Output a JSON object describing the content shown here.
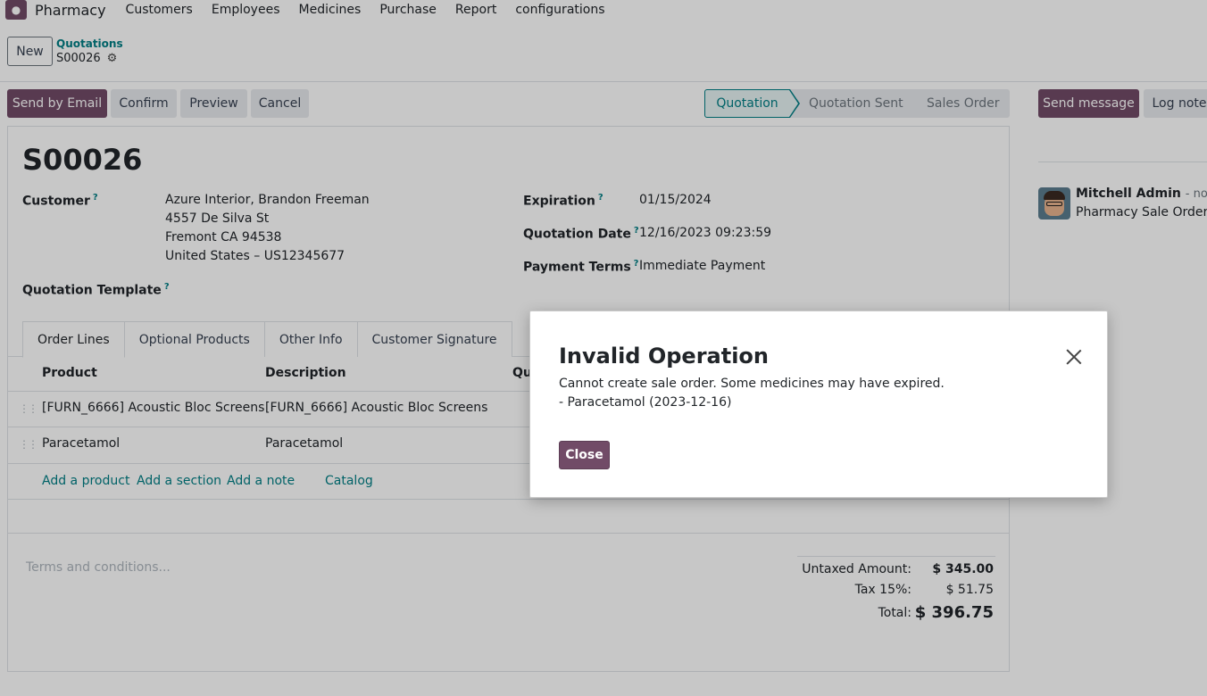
{
  "app": {
    "name": "Pharmacy",
    "icon": "app-logo-icon"
  },
  "menu": [
    "Customers",
    "Employees",
    "Medicines",
    "Purchase",
    "Report",
    "configurations"
  ],
  "control": {
    "new_label": "New",
    "breadcrumb_parent": "Quotations",
    "breadcrumb_current": "S00026"
  },
  "actions": {
    "send_email": "Send by Email",
    "confirm": "Confirm",
    "preview": "Preview",
    "cancel": "Cancel"
  },
  "stages": {
    "active": "Quotation",
    "sent": "Quotation Sent",
    "order": "Sales Order"
  },
  "chatter": {
    "send_message": "Send message",
    "log_note": "Log note",
    "author": "Mitchell Admin",
    "time": "- now",
    "message": "Pharmacy Sale Order cr"
  },
  "form": {
    "title": "S00026",
    "customer_label": "Customer",
    "customer_lines": [
      "Azure Interior, Brandon Freeman",
      "4557 De Silva St",
      "Fremont CA 94538",
      "United States – US12345677"
    ],
    "template_label": "Quotation Template",
    "expiration_label": "Expiration",
    "expiration_value": "01/15/2024",
    "quotation_date_label": "Quotation Date",
    "quotation_date_value": "12/16/2023 09:23:59",
    "payment_terms_label": "Payment Terms",
    "payment_terms_value": "Immediate Payment",
    "help_mark": "?"
  },
  "tabs": [
    "Order Lines",
    "Optional Products",
    "Other Info",
    "Customer Signature"
  ],
  "table": {
    "headers": {
      "product": "Product",
      "description": "Description",
      "quantity": "Qu"
    },
    "rows": [
      {
        "product": "[FURN_6666] Acoustic Bloc Screens",
        "description": "[FURN_6666] Acoustic Bloc Screens"
      },
      {
        "product": "Paracetamol",
        "description": "Paracetamol"
      }
    ],
    "add_product": "Add a product",
    "add_section": "Add a section",
    "add_note": "Add a note",
    "catalog": "Catalog"
  },
  "terms_placeholder": "Terms and conditions...",
  "totals": {
    "untaxed_label": "Untaxed Amount:",
    "untaxed_value": "$ 345.00",
    "tax_label": "Tax 15%:",
    "tax_value": "$ 51.75",
    "total_label": "Total:",
    "total_value": "$ 396.75"
  },
  "dialog": {
    "title": "Invalid Operation",
    "line1": "Cannot create sale order. Some medicines may have expired.",
    "line2": "- Paracetamol (2023-12-16)",
    "close_label": "Close"
  },
  "colors": {
    "primary": "#714b67",
    "accent": "#017e84"
  }
}
